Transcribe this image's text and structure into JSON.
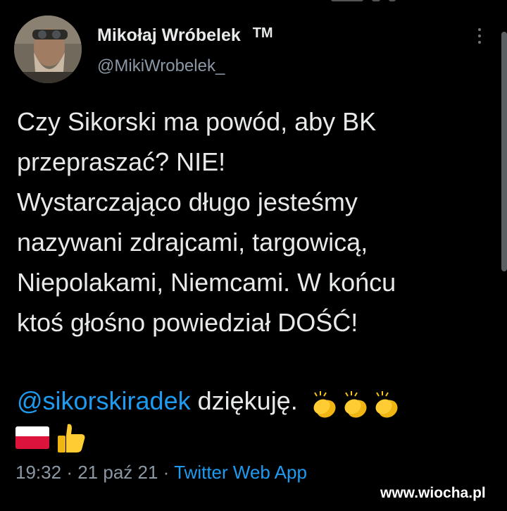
{
  "author": {
    "name": "Mikołaj Wróbelek",
    "badge": "TM",
    "handle": "@MikiWrobelek_"
  },
  "tweet": {
    "lines": [
      "Czy Sikorski ma powód, aby BK",
      "przepraszać? NIE!",
      "Wystarczająco długo jesteśmy",
      "nazywani zdrajcami, targowicą,",
      "Niepolakami, Niemcami. W końcu",
      "ktoś głośno powiedział DOŚĆ!"
    ],
    "mention": "@sikorskiradek",
    "thanks": "dziękuję."
  },
  "icons": {
    "avatar": "profile-photo",
    "more": "more-vertical-icon",
    "clap": "clapping-hands-emoji",
    "flag": "poland-flag-emoji",
    "thumb": "thumbs-up-emoji"
  },
  "meta": {
    "time": "19:32",
    "date": "21 paź 21",
    "separator": "·",
    "source": "Twitter Web App"
  },
  "watermark": "www.wiocha.pl",
  "colors": {
    "background": "#000000",
    "text": "#e7e9ea",
    "muted": "#8b98a5",
    "link": "#1d9bf0"
  }
}
